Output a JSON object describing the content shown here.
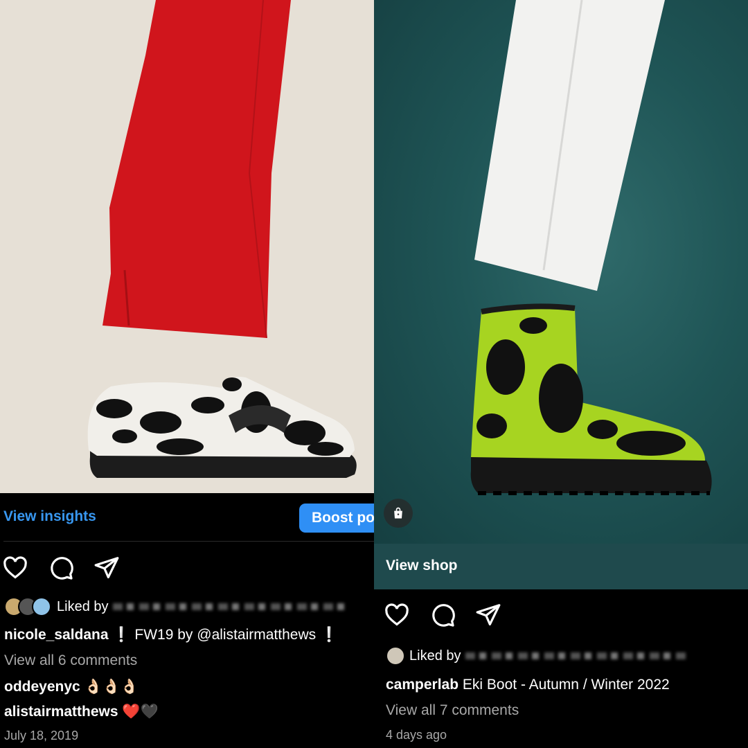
{
  "left_post": {
    "insights_label": "View insights",
    "boost_label": "Boost post",
    "liked_prefix": "Liked by",
    "caption_user": "nicole_saldana",
    "caption_text": " ❕ FW19 by @alistairmatthews ❕",
    "view_comments": "View all 6 comments",
    "comments": [
      {
        "user": "oddeyenyc",
        "text": " 👌🏻👌🏻👌🏻"
      },
      {
        "user": "alistairmatthews",
        "text": " ❤️🖤"
      }
    ],
    "date": "July 18, 2019"
  },
  "right_post": {
    "view_shop_label": "View shop",
    "liked_prefix": "Liked by",
    "caption_user": "camperlab",
    "caption_text": " Eki Boot - Autumn / Winter 2022",
    "view_comments": "View all 7 comments",
    "date": "4 days ago"
  },
  "colors": {
    "link_blue": "#3897f0",
    "boost_blue": "#2f8ff5",
    "shop_bar": "#1f4a4d",
    "left_bg": "#e6e0d6",
    "right_bg": "#1f5556"
  },
  "icons": [
    "heart-icon",
    "comment-icon",
    "share-icon",
    "shopping-bag-icon"
  ]
}
